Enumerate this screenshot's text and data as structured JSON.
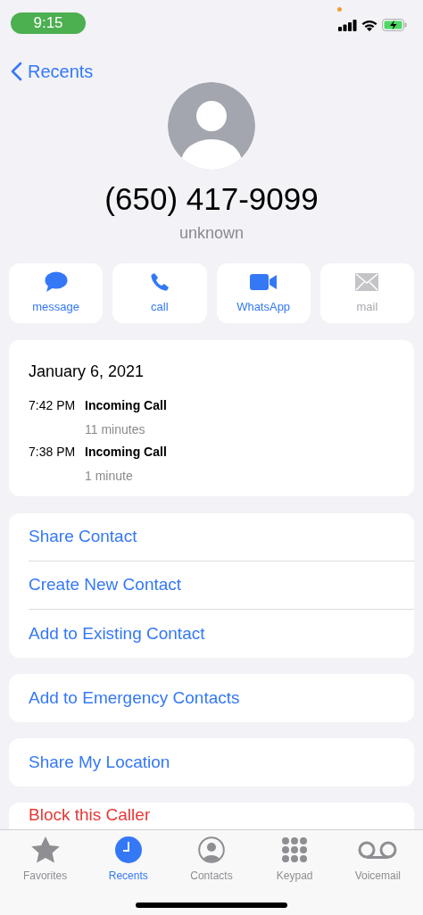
{
  "status_bar": {
    "time": "9:15"
  },
  "nav": {
    "back": "Recents"
  },
  "contact": {
    "number": "(650) 417-9099",
    "label": "unknown"
  },
  "actions": [
    {
      "label": "message",
      "disabled": false
    },
    {
      "label": "call",
      "disabled": false
    },
    {
      "label": "WhatsApp",
      "disabled": false
    },
    {
      "label": "mail",
      "disabled": true
    }
  ],
  "call_history": {
    "date": "January 6, 2021",
    "calls": [
      {
        "time": "7:42 PM",
        "type": "Incoming Call",
        "duration": "11 minutes"
      },
      {
        "time": "7:38 PM",
        "type": "Incoming Call",
        "duration": "1 minute"
      }
    ]
  },
  "option_groups": [
    {
      "items": [
        {
          "label": "Share Contact",
          "kind": "normal"
        },
        {
          "label": "Create New Contact",
          "kind": "normal"
        },
        {
          "label": "Add to Existing Contact",
          "kind": "normal"
        }
      ]
    },
    {
      "items": [
        {
          "label": "Add to Emergency Contacts",
          "kind": "normal"
        }
      ]
    },
    {
      "items": [
        {
          "label": "Share My Location",
          "kind": "normal"
        }
      ]
    },
    {
      "items": [
        {
          "label": "Block this Caller",
          "kind": "destructive"
        }
      ]
    }
  ],
  "tab_bar": [
    {
      "label": "Favorites",
      "selected": false
    },
    {
      "label": "Recents",
      "selected": true
    },
    {
      "label": "Contacts",
      "selected": false
    },
    {
      "label": "Keypad",
      "selected": false
    },
    {
      "label": "Voicemail",
      "selected": false
    }
  ]
}
